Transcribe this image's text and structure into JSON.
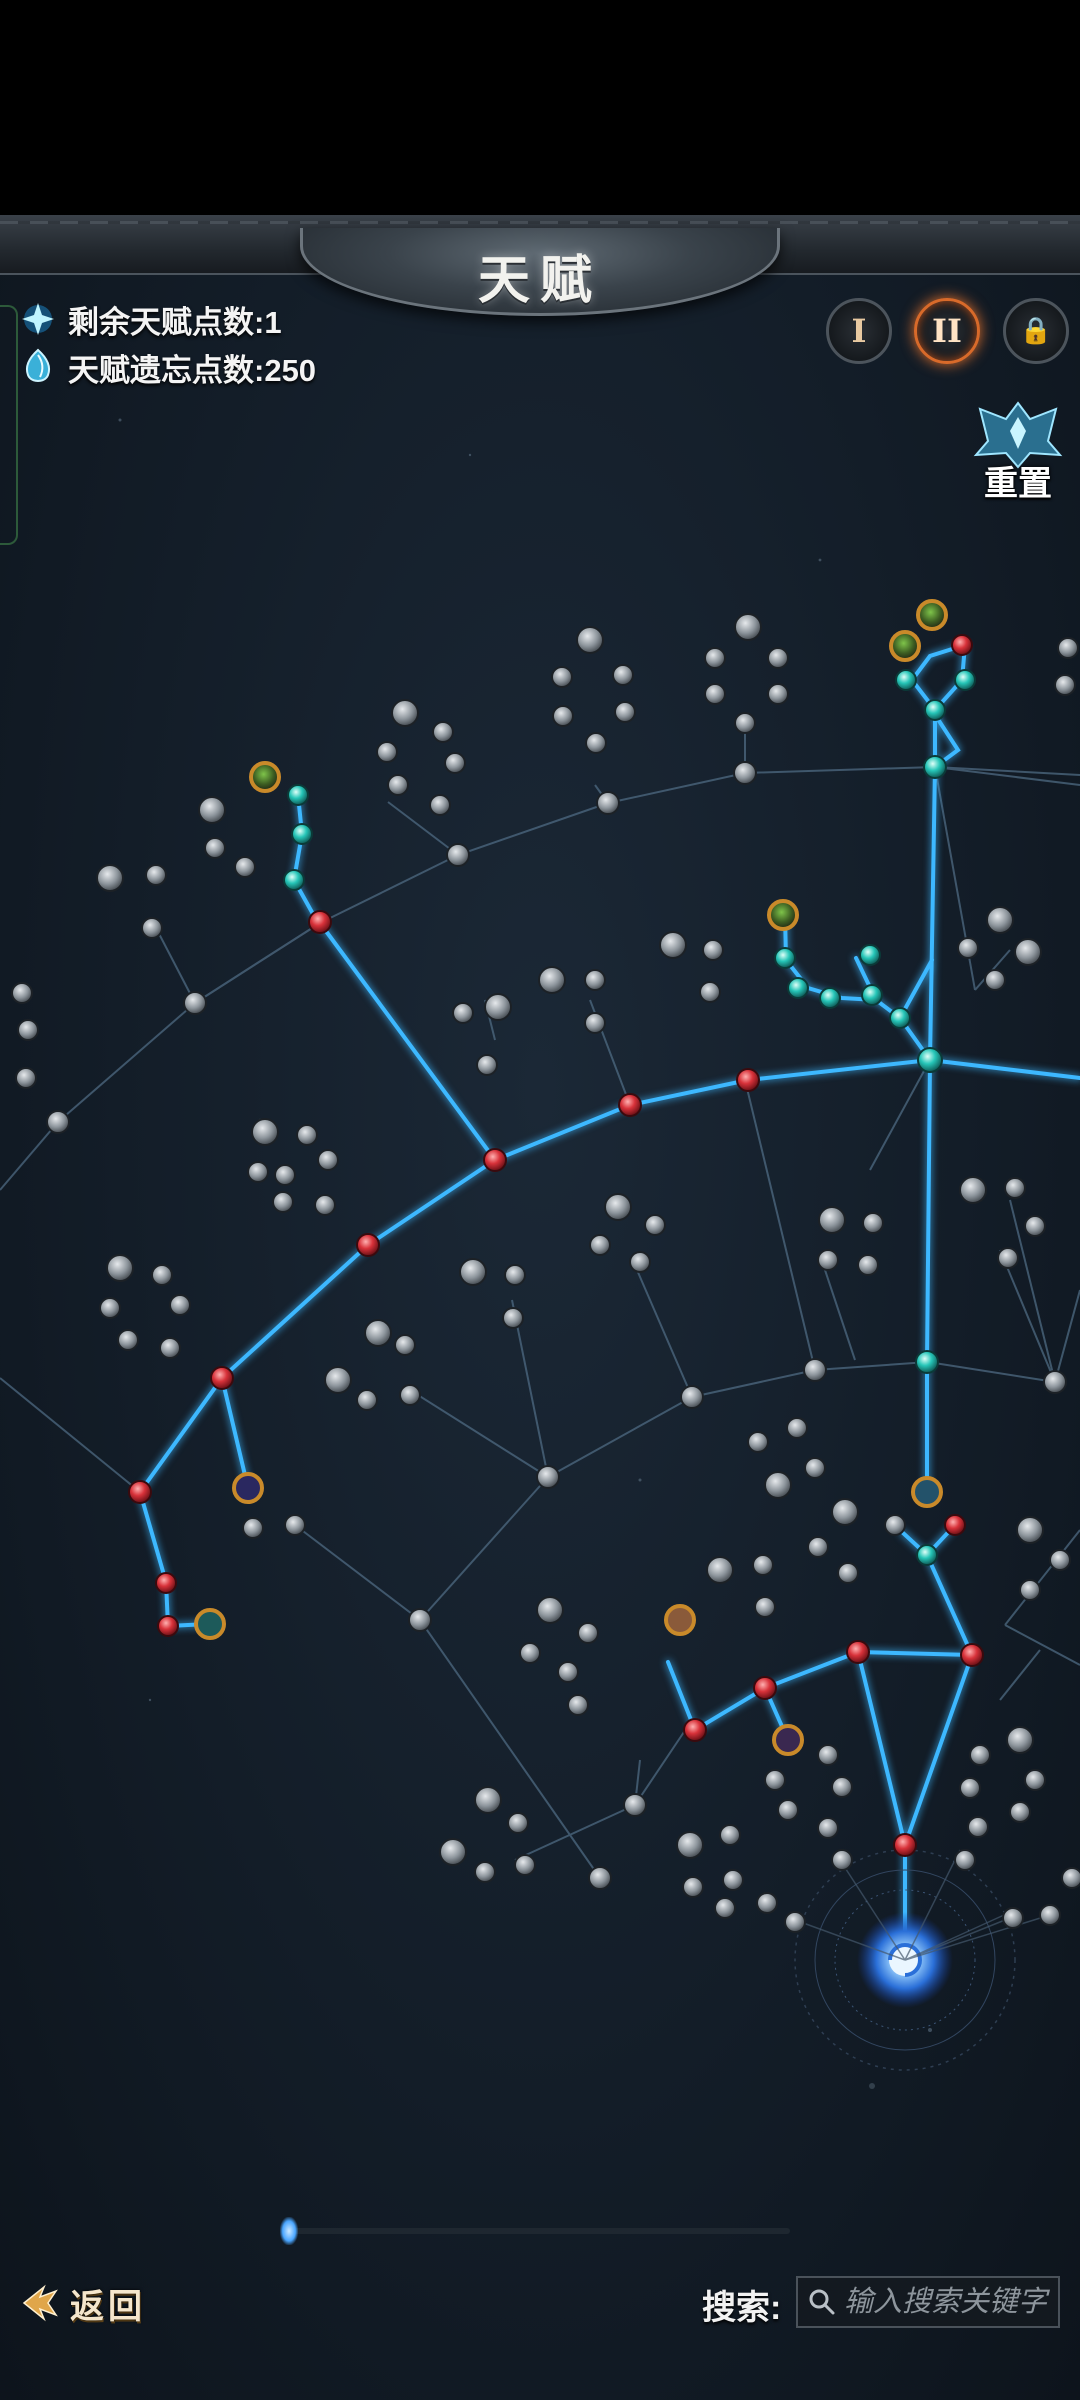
{
  "header": {
    "title": "天赋"
  },
  "points": {
    "remaining_label": "剩余天赋点数:1",
    "forget_label": "天赋遗忘点数:250"
  },
  "pages": [
    {
      "label": "I",
      "state": "normal"
    },
    {
      "label": "II",
      "state": "active"
    },
    {
      "label": "🔒",
      "state": "locked"
    }
  ],
  "reset": {
    "label": "重置"
  },
  "footer": {
    "back_label": "返回",
    "search_label": "搜索:",
    "search_placeholder": "输入搜索关键字"
  },
  "colors": {
    "active_link": "#3db8ff",
    "inactive_link": "#4e6a82",
    "red_node": "#d8323a",
    "teal_node": "#26c6b8",
    "gold_ring": "#c98a2a"
  },
  "icons": {
    "talent_point": "blue-star-gem-icon",
    "forget_point": "blue-crystal-icon",
    "back": "back-arrow-icon",
    "search": "magnifier-icon",
    "reset": "winged-crest-icon",
    "core": "blue-swirl-core-icon"
  }
}
